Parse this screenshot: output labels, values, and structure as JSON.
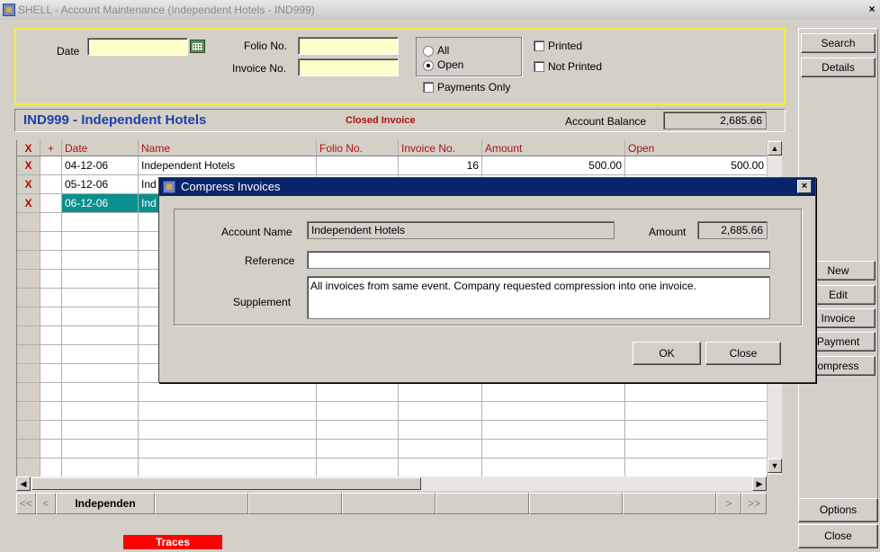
{
  "window": {
    "title": "SHELL - Account Maintenance (Independent Hotels - IND999)",
    "close_glyph": "×"
  },
  "search": {
    "date_label": "Date",
    "date_value": "",
    "folio_label": "Folio No.",
    "folio_value": "",
    "invoice_label": "Invoice No.",
    "invoice_value": "",
    "radio_all": "All",
    "radio_open": "Open",
    "selected_filter": "Open",
    "payments_only": "Payments Only",
    "printed": "Printed",
    "not_printed": "Not Printed"
  },
  "account": {
    "title": "IND999 - Independent Hotels",
    "status": "Closed Invoice",
    "balance_label": "Account Balance",
    "balance_value": "2,685.66"
  },
  "grid": {
    "columns": [
      "Date",
      "Name",
      "Folio No.",
      "Invoice No.",
      "Amount",
      "Open"
    ],
    "sort_glyph": "+",
    "row_marker": "X",
    "rows": [
      {
        "date": "04-12-06",
        "name": "Independent Hotels",
        "folio": "",
        "invoice": "16",
        "amount": "500.00",
        "open": "500.00"
      },
      {
        "date": "05-12-06",
        "name": "Ind",
        "folio": "",
        "invoice": "",
        "amount": "",
        "open": ""
      },
      {
        "date": "06-12-06",
        "name": "Ind",
        "folio": "",
        "invoice": "",
        "amount": "",
        "open": ""
      }
    ]
  },
  "tabs": {
    "first": "<<",
    "prev": "<",
    "active": "Independen",
    "next": ">",
    "last": ">>"
  },
  "traces_label": "Traces",
  "side_buttons": {
    "search": "Search",
    "details": "Details",
    "new": "New",
    "edit": "Edit",
    "invoice": "Invoice",
    "payment": "Payment",
    "compress": "ompress",
    "options": "Options",
    "close": "Close"
  },
  "dialog": {
    "title": "Compress Invoices",
    "close_glyph": "×",
    "account_name_label": "Account Name",
    "account_name_value": "Independent Hotels",
    "amount_label": "Amount",
    "amount_value": "2,685.66",
    "reference_label": "Reference",
    "reference_value": "",
    "supplement_label": "Supplement",
    "supplement_value": "All invoices from same event.  Company requested compression into one invoice.",
    "ok_label": "OK",
    "close_label": "Close"
  },
  "colors": {
    "title_bar": "#0a246a",
    "input_yellow": "#ffffcc",
    "selected_row": "#0b8f8f",
    "account_title": "#1e3fa8",
    "traces": "#ff0000"
  }
}
